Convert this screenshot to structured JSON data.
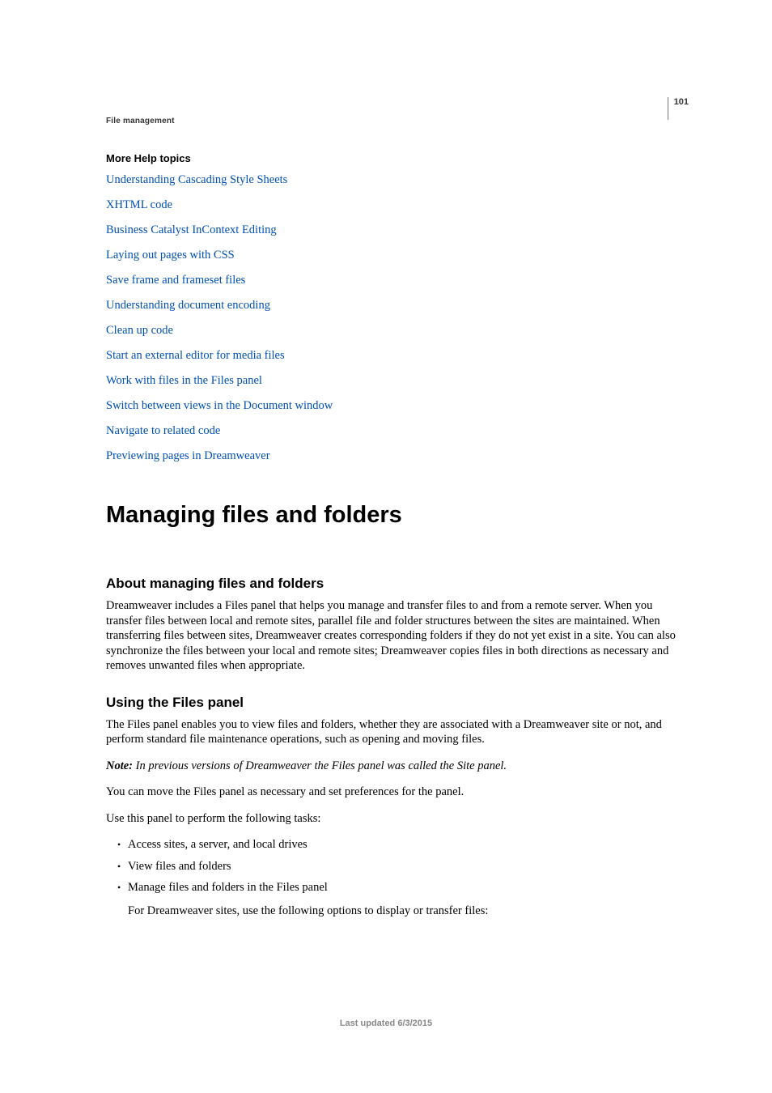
{
  "page_number": "101",
  "running_header": "File management",
  "more_help": {
    "heading": "More Help topics",
    "links": [
      "Understanding Cascading Style Sheets",
      "XHTML code",
      "Business Catalyst InContext Editing",
      "Laying out pages with CSS",
      "Save frame and frameset files",
      "Understanding document encoding",
      "Clean up code",
      "Start an external editor for media files",
      "Work with files in the Files panel",
      "Switch between views in the Document window",
      "Navigate to related code",
      "Previewing pages in Dreamweaver"
    ]
  },
  "h1": "Managing files and folders",
  "section1": {
    "heading": "About managing files and folders",
    "p1": "Dreamweaver includes a Files panel that helps you manage and transfer files to and from a remote server. When you transfer files between local and remote sites, parallel file and folder structures between the sites are maintained. When transferring files between sites, Dreamweaver creates corresponding folders if they do not yet exist in a site. You can also synchronize the files between your local and remote sites; Dreamweaver copies files in both directions as necessary and removes unwanted files when appropriate."
  },
  "section2": {
    "heading": "Using the Files panel",
    "p1": "The Files panel enables you to view files and folders, whether they are associated with a Dreamweaver site or not, and perform standard file maintenance operations, such as opening and moving files.",
    "note_label": "Note:",
    "note_body": " In previous versions of Dreamweaver the Files panel was called the Site panel.",
    "p2": "You can move the Files panel as necessary and set preferences for the panel.",
    "p3": "Use this panel to perform the following tasks:",
    "bullets": [
      "Access sites, a server, and local drives",
      "View files and folders",
      "Manage files and folders in the Files panel"
    ],
    "sub_body": "For Dreamweaver sites, use the following options to display or transfer files:"
  },
  "footer": "Last updated 6/3/2015"
}
